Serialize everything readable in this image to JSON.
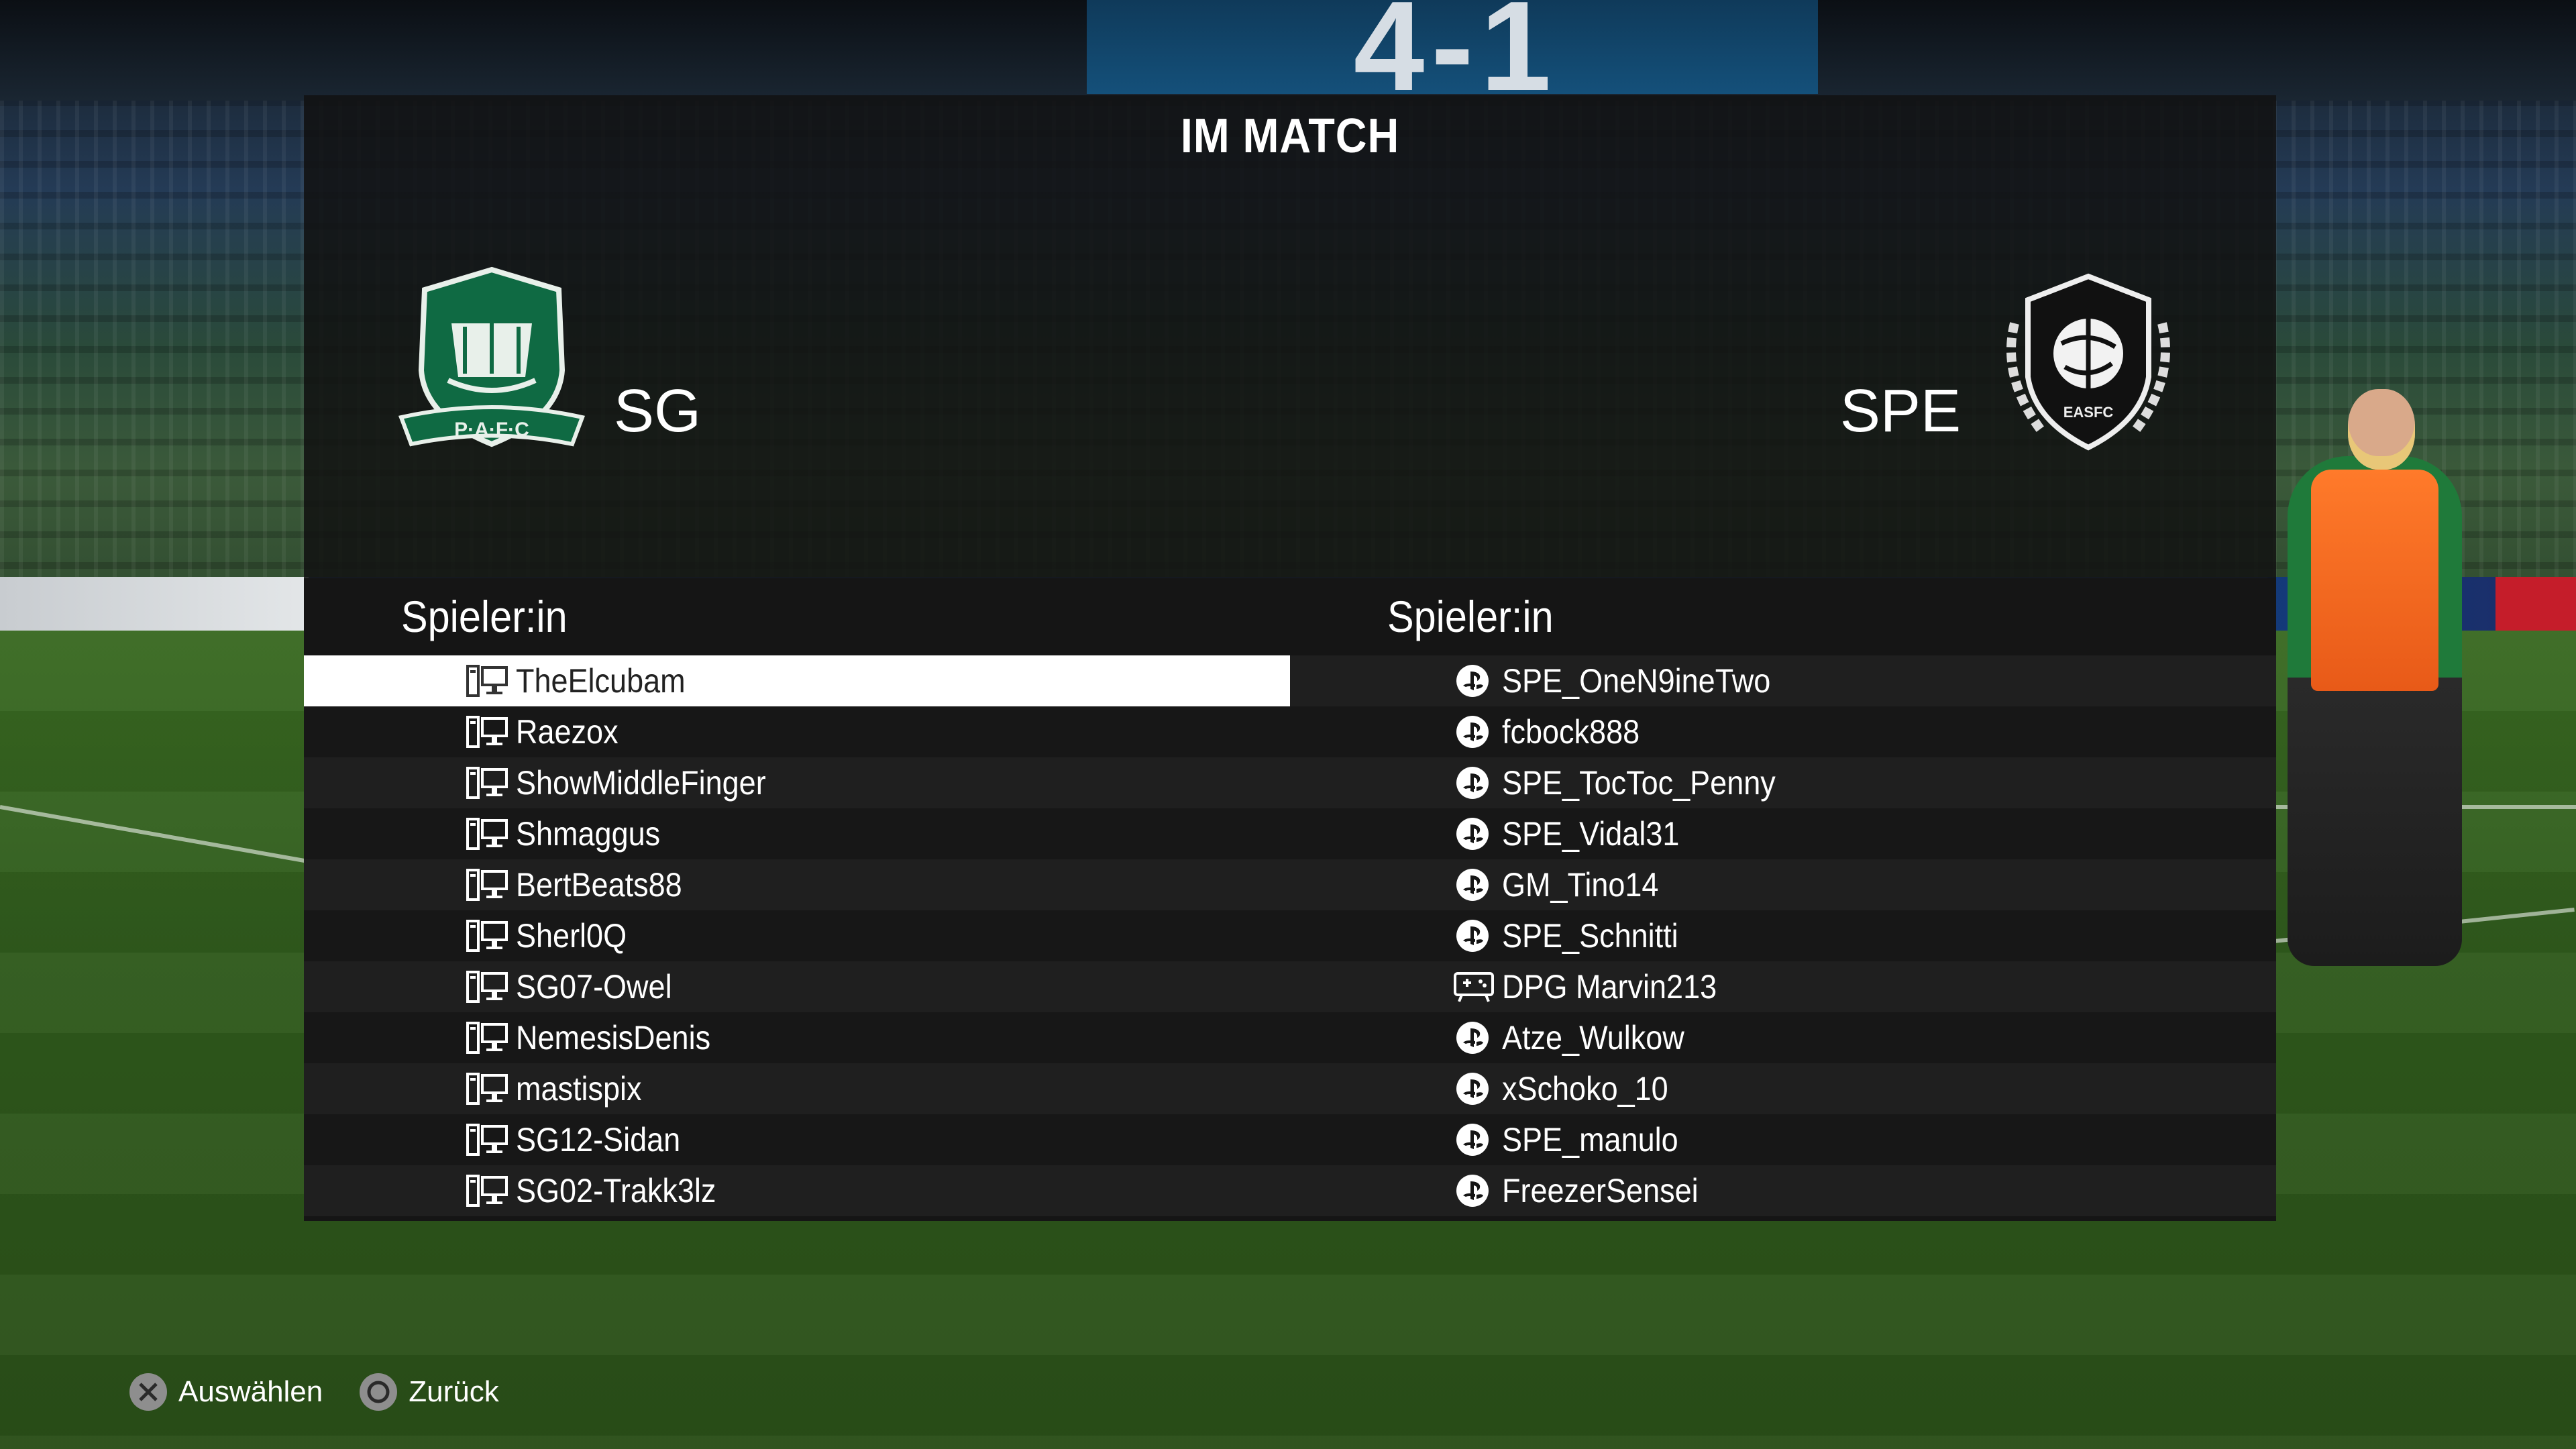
{
  "scoreboard": {
    "score": "4-1"
  },
  "panel": {
    "title": "IM MATCH",
    "home": {
      "abbr": "SG",
      "crest_text": "P·A·F·C",
      "color": "#0f6a43"
    },
    "away": {
      "abbr": "SPE",
      "crest_text": "EASFC",
      "color": "#111111"
    }
  },
  "columns": {
    "home_header": "Spieler:in",
    "away_header": "Spieler:in"
  },
  "home_players": [
    {
      "name": "TheElcubam",
      "platform": "pc-icon",
      "selected": true
    },
    {
      "name": "Raezox",
      "platform": "pc-icon"
    },
    {
      "name": "ShowMiddleFinger",
      "platform": "pc-icon"
    },
    {
      "name": "Shmaggus",
      "platform": "pc-icon"
    },
    {
      "name": "BertBeats88",
      "platform": "pc-icon"
    },
    {
      "name": "Sherl0Q",
      "platform": "pc-icon"
    },
    {
      "name": "SG07-Owel",
      "platform": "pc-icon"
    },
    {
      "name": "NemesisDenis",
      "platform": "pc-icon"
    },
    {
      "name": "mastispix",
      "platform": "pc-icon"
    },
    {
      "name": "SG12-Sidan",
      "platform": "pc-icon"
    },
    {
      "name": "SG02-Trakk3lz",
      "platform": "pc-icon"
    }
  ],
  "away_players": [
    {
      "name": "SPE_OneN9ineTwo",
      "platform": "playstation-icon"
    },
    {
      "name": "fcbock888",
      "platform": "playstation-icon"
    },
    {
      "name": "SPE_TocToc_Penny",
      "platform": "playstation-icon"
    },
    {
      "name": "SPE_Vidal31",
      "platform": "playstation-icon"
    },
    {
      "name": "GM_Tino14",
      "platform": "playstation-icon"
    },
    {
      "name": "SPE_Schnitti",
      "platform": "playstation-icon"
    },
    {
      "name": "DPG Marvin213",
      "platform": "controller-icon"
    },
    {
      "name": "Atze_Wulkow",
      "platform": "playstation-icon"
    },
    {
      "name": "xSchoko_10",
      "platform": "playstation-icon"
    },
    {
      "name": "SPE_manulo",
      "platform": "playstation-icon"
    },
    {
      "name": "FreezerSensei",
      "platform": "playstation-icon"
    }
  ],
  "footer": {
    "select_label": "Auswählen",
    "back_label": "Zurück"
  }
}
